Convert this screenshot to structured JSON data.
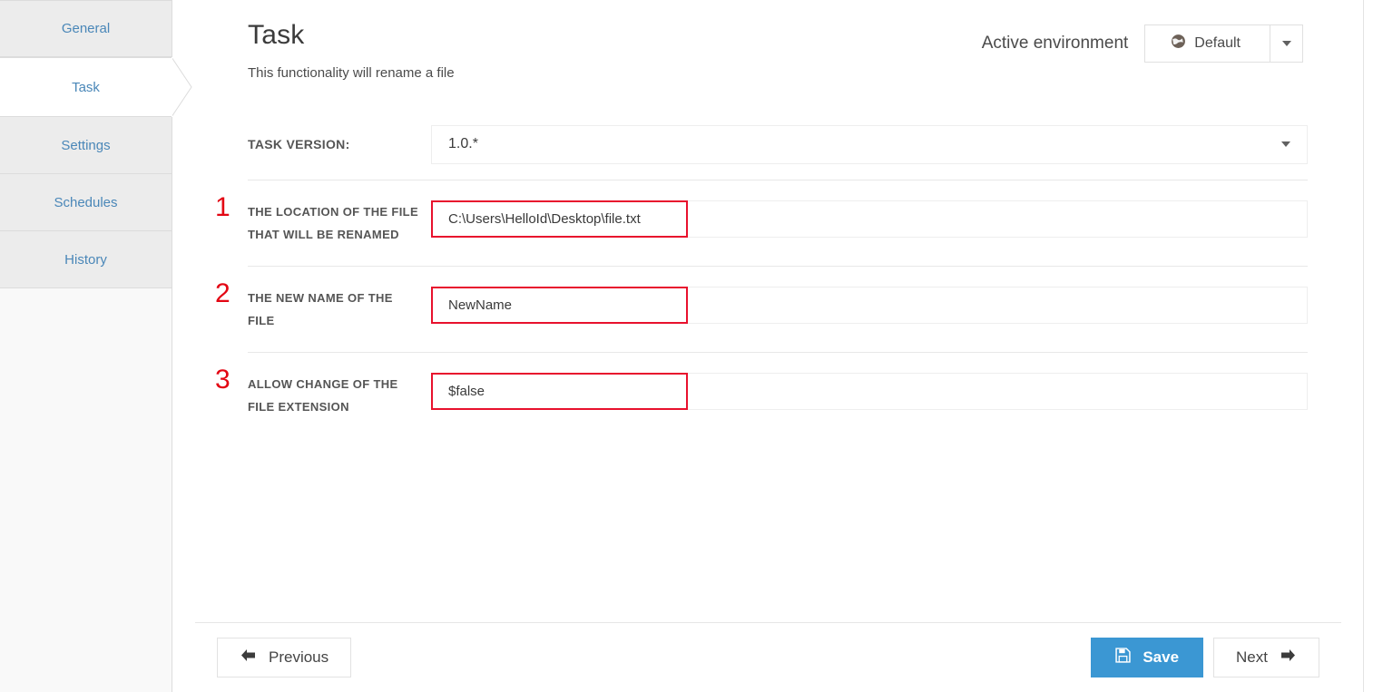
{
  "sidebar": {
    "items": [
      {
        "label": "General",
        "active": false
      },
      {
        "label": "Task",
        "active": true
      },
      {
        "label": "Settings",
        "active": false
      },
      {
        "label": "Schedules",
        "active": false
      },
      {
        "label": "History",
        "active": false
      }
    ]
  },
  "header": {
    "title": "Task",
    "subtitle": "This functionality will rename a file",
    "environment_label": "Active environment",
    "environment_value": "Default",
    "environment_icon": "globe-icon",
    "caret_icon": "chevron-down-icon"
  },
  "form": {
    "version_row": {
      "label": "TASK VERSION:",
      "value": "1.0.*"
    },
    "fields": [
      {
        "number": "1",
        "label": "THE LOCATION OF THE FILE THAT WILL BE RENAMED",
        "value": "C:\\Users\\HelloId\\Desktop\\file.txt",
        "highlighted": true
      },
      {
        "number": "2",
        "label": "THE NEW NAME OF THE FILE",
        "value": "NewName",
        "highlighted": true
      },
      {
        "number": "3",
        "label": "ALLOW CHANGE OF THE FILE EXTENSION",
        "value": "$false",
        "highlighted": true
      }
    ]
  },
  "footer": {
    "previous_label": "Previous",
    "previous_icon": "arrow-left-icon",
    "save_label": "Save",
    "save_icon": "floppy-disk-icon",
    "next_label": "Next",
    "next_icon": "arrow-right-icon"
  },
  "colors": {
    "accent_blue": "#3b97d3",
    "nav_link": "#4a87b8",
    "annotation_red": "#e8112d",
    "number_red": "#e30613"
  }
}
